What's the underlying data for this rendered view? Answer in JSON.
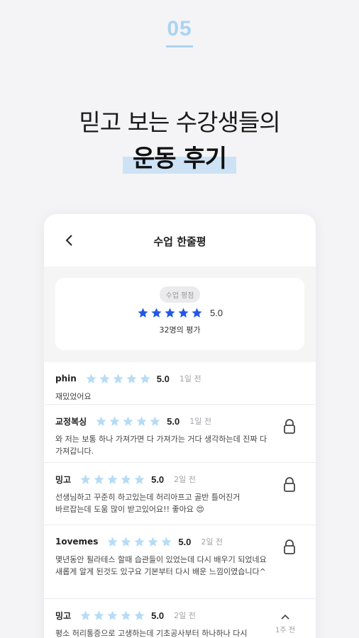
{
  "step": {
    "number": "05"
  },
  "headline": {
    "line1": "믿고 보는 수강생들의",
    "line2": "운동 후기"
  },
  "nav": {
    "title": "수업 한줄평"
  },
  "summary": {
    "pill": "수업 평점",
    "score": "5.0",
    "count": "32명의 평가",
    "stars": 5
  },
  "colors": {
    "accent_light": "#aad3f1",
    "highlight": "#cde3f5",
    "star_summary": "#2457e6",
    "star_review": "#b7dcf6"
  },
  "reviews": [
    {
      "author": "phin",
      "score": "5.0",
      "time": "1일 전",
      "body": "재밌었어요",
      "action": "none"
    },
    {
      "author": "교정복싱",
      "score": "5.0",
      "time": "1일 전",
      "body": "와 저는 보통 하나 가져가면 다 가져가는 거다 생각하는데 진짜 다 가져갑니다.",
      "action": "lock-icon"
    },
    {
      "author": "밍고",
      "score": "5.0",
      "time": "2일 전",
      "body": "선생님하고 꾸준히 하고있는데 허리아프고 골반 틀어진거 바르잡는데 도움 많이 받고있어요!! 좋아요 😍",
      "action": "lock-icon"
    },
    {
      "author": "1ovemes",
      "score": "5.0",
      "time": "2일 전",
      "body": "몇년동안 필라테스 할때 습관들이 있었는데 다시 배우기 되었네요 새롭게 알게 된것도 있구요 기본부터 다시 배운 느낌이였습니다^",
      "action": "lock-icon"
    },
    {
      "author": "밍고",
      "score": "5.0",
      "time": "2일 전",
      "body": "평소 허리통증으로 고생하는데 기초공사부터 하나하나 다시 쌓아올리는 느낌이였으면 요소 요소 쏙 이었음에 진생",
      "action": "chevron-up-icon",
      "action_label": "1주 전"
    }
  ]
}
